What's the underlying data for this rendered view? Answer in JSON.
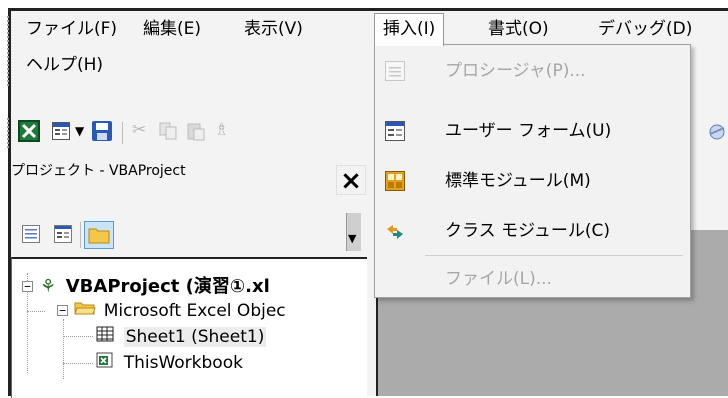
{
  "menubar": {
    "items": [
      {
        "label": "ファイル(F)"
      },
      {
        "label": "編集(E)"
      },
      {
        "label": "表示(V)"
      },
      {
        "label": "挿入(I)"
      },
      {
        "label": "書式(O)"
      },
      {
        "label": "デバッグ(D)"
      },
      {
        "label": "ヘルプ(H)"
      }
    ]
  },
  "insert_menu": {
    "items": [
      {
        "label": "プロシージャ(P)...",
        "icon": "procedure-icon",
        "enabled": false
      },
      {
        "label": "ユーザー フォーム(U)",
        "icon": "userform-icon",
        "enabled": true
      },
      {
        "label": "標準モジュール(M)",
        "icon": "standard-module-icon",
        "enabled": true
      },
      {
        "label": "クラス モジュール(C)",
        "icon": "class-module-icon",
        "enabled": true
      },
      {
        "label": "ファイル(L)...",
        "icon": "",
        "enabled": false
      }
    ]
  },
  "project_explorer": {
    "title": "プロジェクト - VBAProject",
    "close_label": "×",
    "tree": {
      "root": "VBAProject (演習①.xl",
      "folder": "Microsoft Excel Objec",
      "sheet1": "Sheet1 (Sheet1)",
      "workbook": "ThisWorkbook"
    }
  },
  "colors": {
    "menu_bg": "#f3f3f3",
    "dropdown_bg": "#f2f2f2",
    "disabled_text": "#a6a6a6",
    "code_area": "#ababab",
    "excel_green": "#1e7a3c",
    "save_blue": "#2b58b8"
  }
}
